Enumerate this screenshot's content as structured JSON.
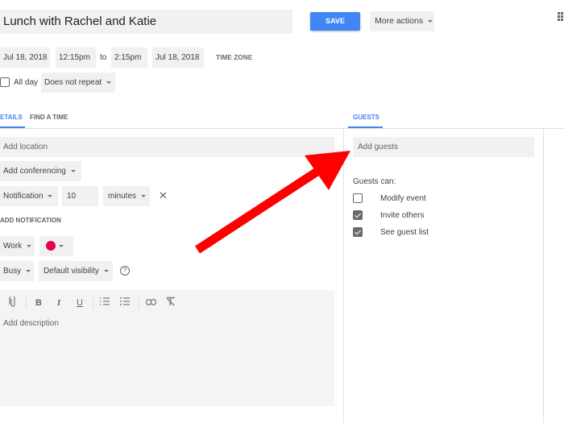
{
  "header": {
    "title_value": "Lunch with Rachel and Katie",
    "save_label": "SAVE",
    "more_actions_label": "More actions",
    "apps_icon": "apps-grid-icon"
  },
  "datetime": {
    "start_date": "Jul 18, 2018",
    "start_time": "12:15pm",
    "to_label": "to",
    "end_time": "2:15pm",
    "end_date": "Jul 18, 2018",
    "time_zone_label": "TIME ZONE",
    "all_day_label": "All day",
    "all_day_checked": false,
    "repeat_value": "Does not repeat"
  },
  "tabs": {
    "details": "ETAILS",
    "find_time": "FIND A TIME",
    "guests": "GUESTS"
  },
  "details": {
    "location_placeholder": "Add location",
    "conferencing_label": "Add conferencing",
    "notification_type": "Notification",
    "notification_amount": "10",
    "notification_unit": "minutes",
    "add_notification_label": "ADD NOTIFICATION",
    "calendar_value": "Work",
    "event_color": "#e8004c",
    "availability_value": "Busy",
    "visibility_value": "Default visibility",
    "description_placeholder": "Add description",
    "toolbar": {
      "attach": "paperclip-icon",
      "bold": "B",
      "italic": "I",
      "underline": "U",
      "numbered_list": "numbered-list-icon",
      "bulleted_list": "bulleted-list-icon",
      "link": "link-icon",
      "clear_format": "clear-formatting-icon"
    }
  },
  "guests": {
    "add_guests_placeholder": "Add guests",
    "permissions_heading": "Guests can:",
    "permissions": [
      {
        "label": "Modify event",
        "checked": false
      },
      {
        "label": "Invite others",
        "checked": true
      },
      {
        "label": "See guest list",
        "checked": true
      }
    ]
  },
  "annotation": {
    "arrow_color": "#ff0000"
  }
}
